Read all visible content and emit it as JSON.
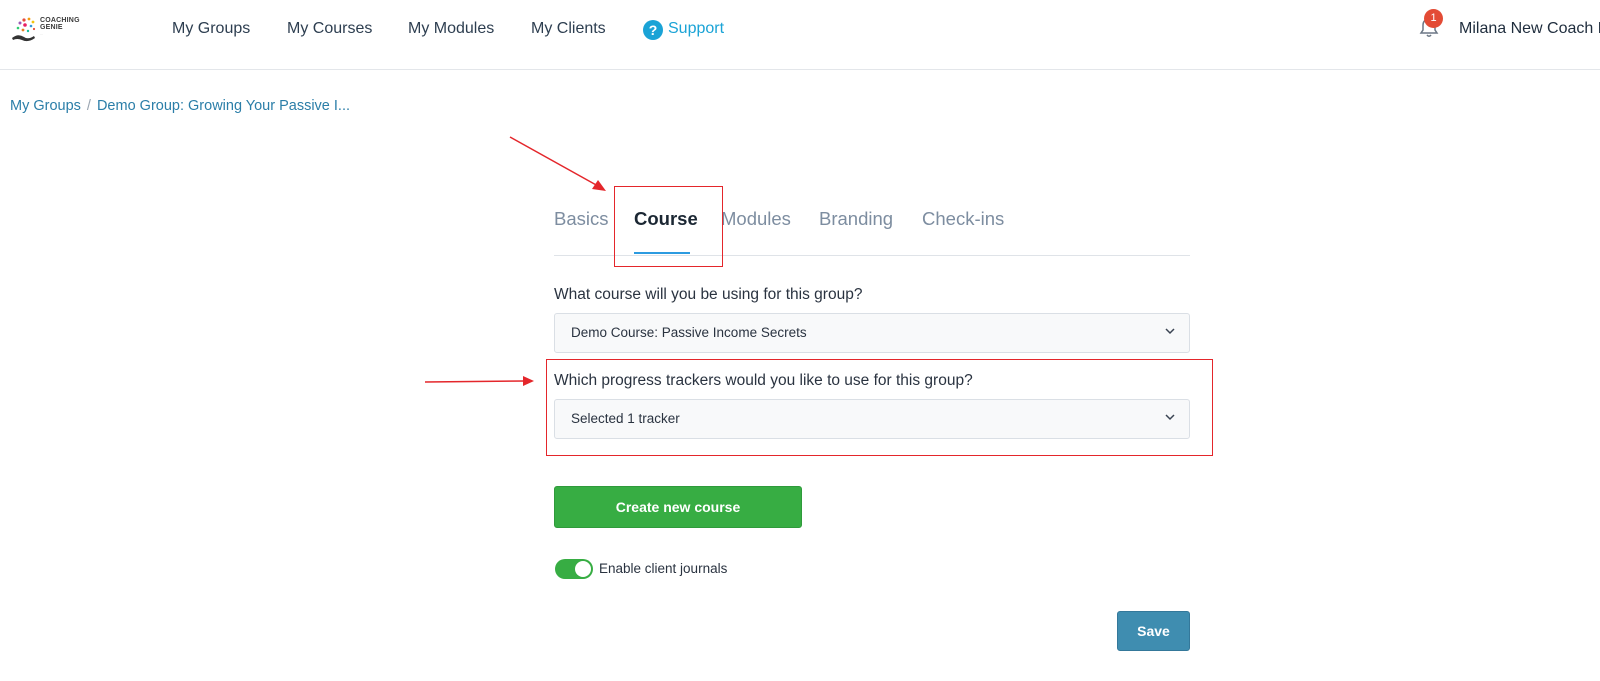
{
  "brand": {
    "name_line1": "COACHING",
    "name_line2": "GENIE",
    "tagline": "...",
    "support_color": "#1aa3d6",
    "accent_green": "#37ad43"
  },
  "nav": {
    "items": [
      {
        "label": "My Groups"
      },
      {
        "label": "My Courses"
      },
      {
        "label": "My Modules"
      },
      {
        "label": "My Clients"
      }
    ],
    "support": {
      "label": "Support",
      "icon": "question-circle-icon"
    }
  },
  "notifications": {
    "count": "1",
    "icon": "bell-icon"
  },
  "user": {
    "name": "Milana New Coach Lo"
  },
  "breadcrumb": {
    "root": "My Groups",
    "separator": "/",
    "current": "Demo Group: Growing Your Passive I..."
  },
  "tabs": [
    {
      "label": "Basics"
    },
    {
      "label": "Course",
      "active": true
    },
    {
      "label": "Modules"
    },
    {
      "label": "Branding"
    },
    {
      "label": "Check-ins"
    }
  ],
  "form": {
    "course_question": "What course will you be using for this group?",
    "course_value": "Demo Course: Passive Income Secrets",
    "tracker_question": "Which progress trackers would you like to use for this group?",
    "tracker_value": "Selected 1 tracker",
    "create_button": "Create new course",
    "journals_toggle_label": "Enable client journals",
    "journals_enabled": true,
    "save_button": "Save"
  },
  "annotations": {
    "color": "#e4262b"
  }
}
